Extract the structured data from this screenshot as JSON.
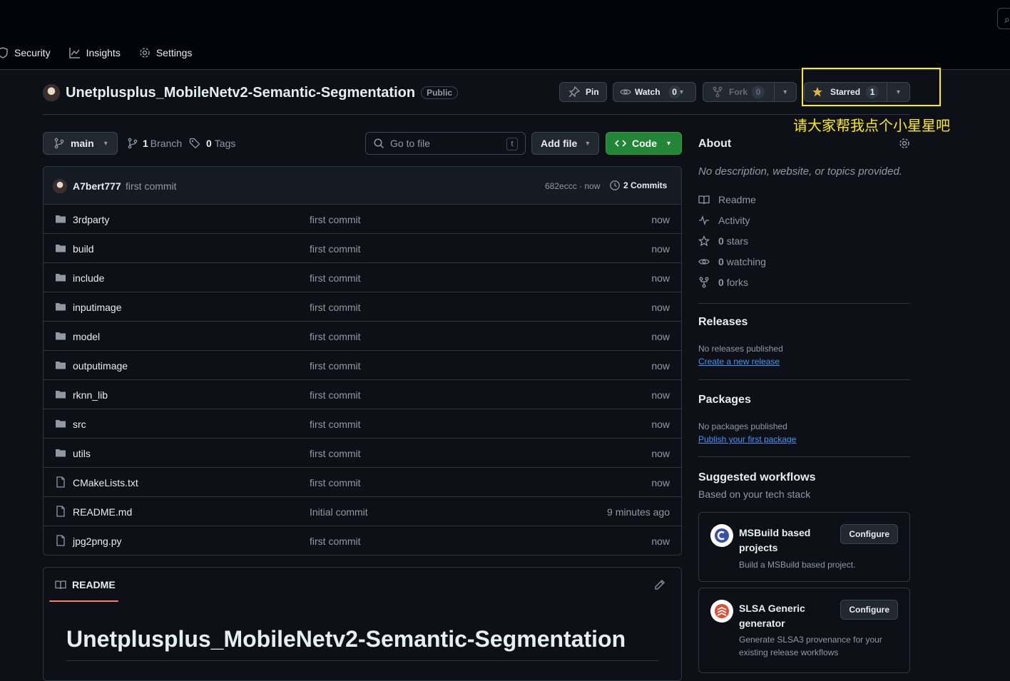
{
  "nav": {
    "items": [
      {
        "label": "Security",
        "icon": "shield-icon"
      },
      {
        "label": "Insights",
        "icon": "graph-icon"
      },
      {
        "label": "Settings",
        "icon": "gear-icon"
      }
    ]
  },
  "repo": {
    "name": "Unetplusplus_MobileNetv2-Semantic-Segmentation",
    "visibility": "Public"
  },
  "actions": {
    "pin_label": "Pin",
    "watch_label": "Watch",
    "watch_count": "0",
    "fork_label": "Fork",
    "fork_count": "0",
    "starred_label": "Starred",
    "star_count": "1"
  },
  "annotation": {
    "text": "请大家帮我点个小星星吧",
    "color": "#ffee00"
  },
  "branch": {
    "current": "main",
    "branch_count": "1",
    "branch_label": "Branch",
    "tag_count": "0",
    "tag_label": "Tags"
  },
  "search": {
    "placeholder": "Go to file",
    "shortcut": "t"
  },
  "buttons": {
    "add_file": "Add file",
    "code": "Code"
  },
  "latest_commit": {
    "author": "A7bert777",
    "message": "first commit",
    "hash_time": "682eccc · now",
    "commits_label": "2 Commits"
  },
  "files": [
    {
      "name": "3rdparty",
      "type": "folder",
      "commit": "first commit",
      "time": "now"
    },
    {
      "name": "build",
      "type": "folder",
      "commit": "first commit",
      "time": "now"
    },
    {
      "name": "include",
      "type": "folder",
      "commit": "first commit",
      "time": "now"
    },
    {
      "name": "inputimage",
      "type": "folder",
      "commit": "first commit",
      "time": "now"
    },
    {
      "name": "model",
      "type": "folder",
      "commit": "first commit",
      "time": "now"
    },
    {
      "name": "outputimage",
      "type": "folder",
      "commit": "first commit",
      "time": "now"
    },
    {
      "name": "rknn_lib",
      "type": "folder",
      "commit": "first commit",
      "time": "now"
    },
    {
      "name": "src",
      "type": "folder",
      "commit": "first commit",
      "time": "now"
    },
    {
      "name": "utils",
      "type": "folder",
      "commit": "first commit",
      "time": "now"
    },
    {
      "name": "CMakeLists.txt",
      "type": "file",
      "commit": "first commit",
      "time": "now"
    },
    {
      "name": "README.md",
      "type": "file",
      "commit": "Initial commit",
      "time": "9 minutes ago"
    },
    {
      "name": "jpg2png.py",
      "type": "file",
      "commit": "first commit",
      "time": "now"
    }
  ],
  "readme": {
    "tab_label": "README",
    "heading": "Unetplusplus_MobileNetv2-Semantic-Segmentation"
  },
  "about": {
    "title": "About",
    "description": "No description, website, or topics provided.",
    "readme_label": "Readme",
    "activity_label": "Activity",
    "stars_count": "0",
    "stars_label": "stars",
    "watching_count": "0",
    "watching_label": "watching",
    "forks_count": "0",
    "forks_label": "forks"
  },
  "releases": {
    "title": "Releases",
    "empty": "No releases published",
    "link": "Create a new release"
  },
  "packages": {
    "title": "Packages",
    "empty": "No packages published",
    "link": "Publish your first package"
  },
  "workflows": {
    "title": "Suggested workflows",
    "subtitle": "Based on your tech stack",
    "items": [
      {
        "name": "MSBuild based projects",
        "description": "Build a MSBuild based project.",
        "button": "Configure"
      },
      {
        "name": "SLSA Generic generator",
        "description": "Generate SLSA3 provenance for your existing release workflows",
        "button": "Configure"
      }
    ]
  },
  "colors": {
    "background": "#0d1117",
    "code_button": "#238636",
    "link": "#4493f8",
    "star": "#e3b341",
    "readme_underline": "#f78166"
  }
}
